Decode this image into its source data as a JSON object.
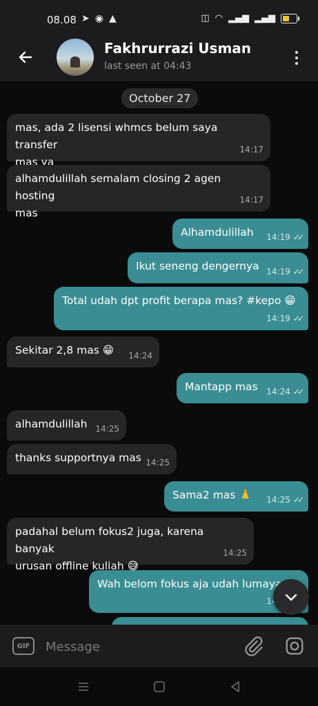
{
  "status": {
    "time": "08.08"
  },
  "header": {
    "name": "Fakhrurrazi Usman",
    "last_seen": "last seen at 04:43"
  },
  "chat": {
    "date": "October 27",
    "messages": [
      {
        "dir": "in",
        "text": "mas, ada 2 lisensi whmcs belum saya transfer\nmas ya",
        "time": "14:17"
      },
      {
        "dir": "in",
        "text": "alhamdulillah semalam closing 2 agen hosting\nmas",
        "time": "14:17"
      },
      {
        "dir": "out",
        "text": "Alhamdulillah",
        "time": "14:19"
      },
      {
        "dir": "out",
        "text": "Ikut seneng dengernya",
        "time": "14:19"
      },
      {
        "dir": "out",
        "text": "Total udah dpt profit berapa mas? #kepo 😁",
        "time": "14:19"
      },
      {
        "dir": "in",
        "text": "Sekitar 2,8 mas 😁",
        "time": "14:24"
      },
      {
        "dir": "out",
        "text": "Mantapp mas",
        "time": "14:24"
      },
      {
        "dir": "in",
        "text": "alhamdulillah",
        "time": "14:25"
      },
      {
        "dir": "in",
        "text": "thanks supportnya mas",
        "time": "14:25"
      },
      {
        "dir": "out",
        "text": "Sama2 mas 🙏",
        "time": "14:25"
      },
      {
        "dir": "in",
        "text": "padahal belum fokus2 juga, karena banyak\nurusan offline kuliah 😅",
        "time": "14:25"
      },
      {
        "dir": "out",
        "text": "Wah belom fokus aja udah lumayan",
        "time": "14:25"
      }
    ]
  },
  "input": {
    "placeholder": "Message",
    "gif_label": "GIF"
  },
  "icons": {
    "back": "arrow-left-icon",
    "menu": "more-vertical-icon",
    "fab": "chevron-down-icon",
    "attach": "paperclip-icon",
    "camera": "camera-icon"
  },
  "colors": {
    "outgoing": "#3a8e93",
    "incoming": "#262628",
    "background": "#0b0b0c"
  }
}
